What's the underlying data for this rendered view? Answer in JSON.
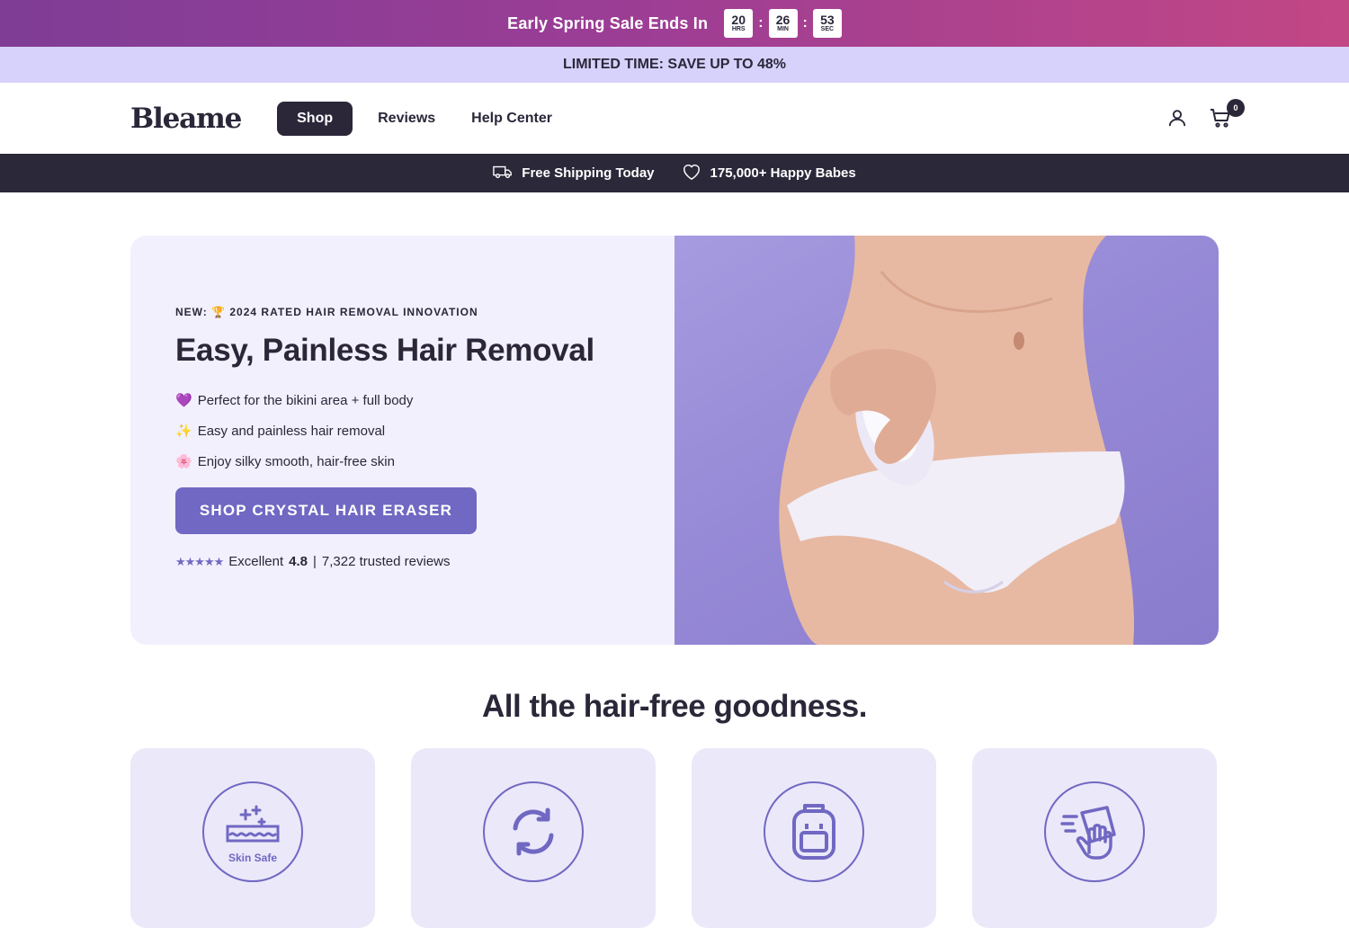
{
  "promo": {
    "text": "Early Spring Sale Ends In",
    "timer": [
      {
        "value": "20",
        "unit": "HRS"
      },
      {
        "value": "26",
        "unit": "MIN"
      },
      {
        "value": "53",
        "unit": "SEC"
      }
    ],
    "separator": ":"
  },
  "limited": {
    "text": "LIMITED TIME: SAVE UP TO 48%"
  },
  "header": {
    "logo": "Bleame",
    "nav": [
      {
        "label": "Shop"
      },
      {
        "label": "Reviews"
      },
      {
        "label": "Help Center"
      }
    ],
    "cart_count": "0"
  },
  "shipbar": {
    "shipping": "Free Shipping Today",
    "babes": "175,000+ Happy Babes"
  },
  "hero": {
    "eyebrow": "NEW: 🏆 2024 RATED HAIR REMOVAL INNOVATION",
    "headline": "Easy, Painless Hair Removal",
    "bullets": [
      {
        "emoji": "💜",
        "text": "Perfect for the bikini area + full body"
      },
      {
        "emoji": "✨",
        "text": "Easy and painless hair removal"
      },
      {
        "emoji": "🌸",
        "text": "Enjoy silky smooth, hair-free skin"
      }
    ],
    "cta": "SHOP CRYSTAL HAIR ERASER",
    "rating": {
      "stars": "★★★★★",
      "label": "Excellent",
      "score": "4.8",
      "divider": "|",
      "reviews": "7,322 trusted reviews"
    }
  },
  "section": {
    "title": "All the hair-free goodness.",
    "features": [
      {
        "icon": "skin-safe-icon",
        "label": "Skin Safe"
      },
      {
        "icon": "refresh-icon"
      },
      {
        "icon": "backpack-icon"
      },
      {
        "icon": "hand-wipe-icon"
      }
    ]
  },
  "colors": {
    "primary": "#2b2739",
    "accent": "#7068c2",
    "hero_bg": "#f2f0fd",
    "feature_bg": "#ebe8f9",
    "limited_bg": "#d7d2fb"
  }
}
